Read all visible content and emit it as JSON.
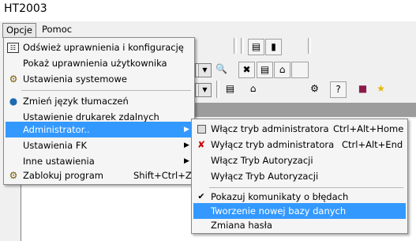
{
  "window": {
    "title": "HT2003"
  },
  "menubar": {
    "items": [
      "Opcje",
      "Pomoc"
    ]
  },
  "opcje_menu": {
    "items": [
      {
        "label": "Odśwież uprawnienia i konfigurację",
        "icon": "refresh-config-icon"
      },
      {
        "label": "Pokaż uprawnienia użytkownika"
      },
      {
        "label": "Ustawienia systemowe",
        "icon": "system-settings-icon"
      },
      {
        "label": "Zmień język tłumaczeń",
        "icon": "language-icon"
      },
      {
        "label": "Ustawienie drukarek zdalnych"
      },
      {
        "label": "Administrator..",
        "submenu": true,
        "highlighted": true
      },
      {
        "label": "Ustawienia FK",
        "submenu": true
      },
      {
        "label": "Inne ustawienia",
        "submenu": true
      },
      {
        "label": "Zablokuj program",
        "icon": "lock-program-icon",
        "shortcut": "Shift+Ctrl+Z"
      }
    ]
  },
  "admin_submenu": {
    "items": [
      {
        "label": "Włącz tryb administratora",
        "shortcut": "Ctrl+Alt+Home",
        "icon": "square-icon"
      },
      {
        "label": "Wyłącz tryb administratora",
        "shortcut": "Ctrl+Alt+End",
        "icon": "red-x-icon"
      },
      {
        "label": "Włącz Tryb Autoryzacji"
      },
      {
        "label": "Wyłącz Tryb Autoryzacji"
      },
      {
        "label": "Pokazuj komunikaty o błędach",
        "checked": true
      },
      {
        "label": "Tworzenie nowej bazy danych",
        "highlighted": true
      },
      {
        "label": "Zmiana hasła"
      }
    ]
  },
  "colors": {
    "highlight": "#3399ff",
    "menu_bg": "#f5f5f5",
    "content_bg": "#ffffff"
  }
}
